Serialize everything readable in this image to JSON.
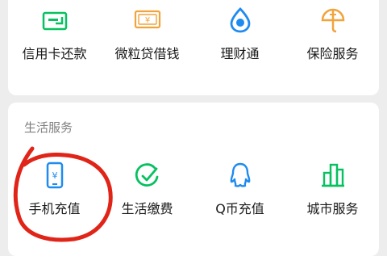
{
  "top_services": [
    {
      "label": "信用卡还款",
      "icon": "credit-card-icon"
    },
    {
      "label": "微粒贷借钱",
      "icon": "money-bill-icon"
    },
    {
      "label": "理财通",
      "icon": "wealth-drop-icon"
    },
    {
      "label": "保险服务",
      "icon": "umbrella-icon"
    }
  ],
  "life_section": {
    "title": "生活服务",
    "items": [
      {
        "label": "手机充值",
        "icon": "phone-topup-icon"
      },
      {
        "label": "生活缴费",
        "icon": "check-circle-icon"
      },
      {
        "label": "Q币充值",
        "icon": "qq-penguin-icon"
      },
      {
        "label": "城市服务",
        "icon": "city-buildings-icon"
      }
    ]
  },
  "colors": {
    "green": "#07c160",
    "orange": "#f1a43b",
    "blue": "#1e8bf0",
    "annotation_red": "#e02418"
  }
}
